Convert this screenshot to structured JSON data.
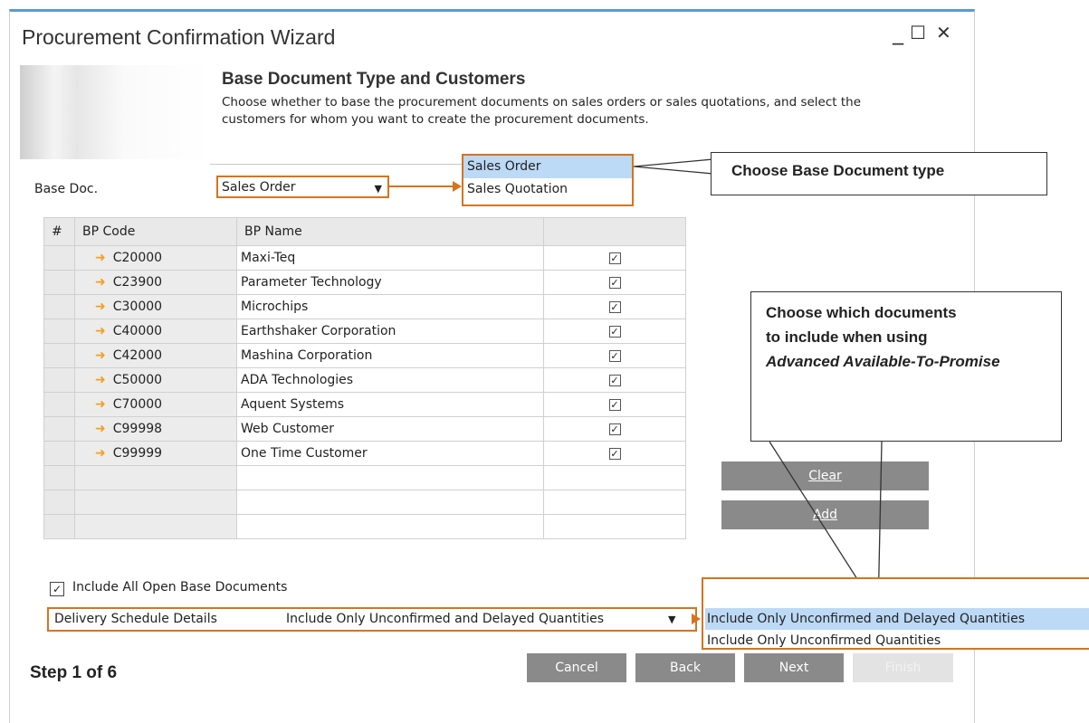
{
  "window": {
    "title": "Procurement Confirmation Wizard",
    "minimize": "_",
    "maximize": "☐",
    "close": "✕"
  },
  "header": {
    "title": "Base Document Type and Customers",
    "description": "Choose whether to base the procurement documents on sales orders or sales quotations, and select the customers for whom you want to create the procurement documents."
  },
  "base_doc": {
    "label": "Base Doc.",
    "value": "Sales Order",
    "options": [
      "Sales Order",
      "Sales Quotation"
    ]
  },
  "table": {
    "headers": [
      "#",
      "BP Code",
      "BP Name",
      ""
    ],
    "rows": [
      {
        "code": "C20000",
        "name": "Maxi-Teq",
        "checked": true
      },
      {
        "code": "C23900",
        "name": "Parameter Technology",
        "checked": true
      },
      {
        "code": "C30000",
        "name": "Microchips",
        "checked": true
      },
      {
        "code": "C40000",
        "name": "Earthshaker Corporation",
        "checked": true
      },
      {
        "code": "C42000",
        "name": "Mashina Corporation",
        "checked": true
      },
      {
        "code": "C50000",
        "name": "ADA Technologies",
        "checked": true
      },
      {
        "code": "C70000",
        "name": "Aquent Systems",
        "checked": true
      },
      {
        "code": "C99998",
        "name": "Web Customer",
        "checked": true
      },
      {
        "code": "C99999",
        "name": "One Time Customer",
        "checked": true
      }
    ]
  },
  "buttons": {
    "clear": "Clear",
    "add": "Add"
  },
  "include_all": {
    "label": "Include All Open Base Documents",
    "checked": true
  },
  "delivery": {
    "label": "Delivery Schedule Details",
    "value": "Include Only Unconfirmed and Delayed Quantities",
    "options": [
      "Include Only Unconfirmed and Delayed Quantities",
      "Include Only Unconfirmed Quantities"
    ]
  },
  "callouts": {
    "base_doc_type": "Choose Base Document type",
    "documents_line1": "Choose which documents",
    "documents_line2": "to include when using",
    "documents_italic": "Advanced Available-To-Promise"
  },
  "footer": {
    "step": "Step 1 of 6",
    "cancel": "Cancel",
    "back": "Back",
    "next": "Next",
    "finish": "Finish"
  },
  "colors": {
    "accent_orange": "#d7731f",
    "selected_blue": "#bcd9f5",
    "button_grey": "#8a8a8a",
    "title_bar_blue": "#5b9bd5"
  }
}
